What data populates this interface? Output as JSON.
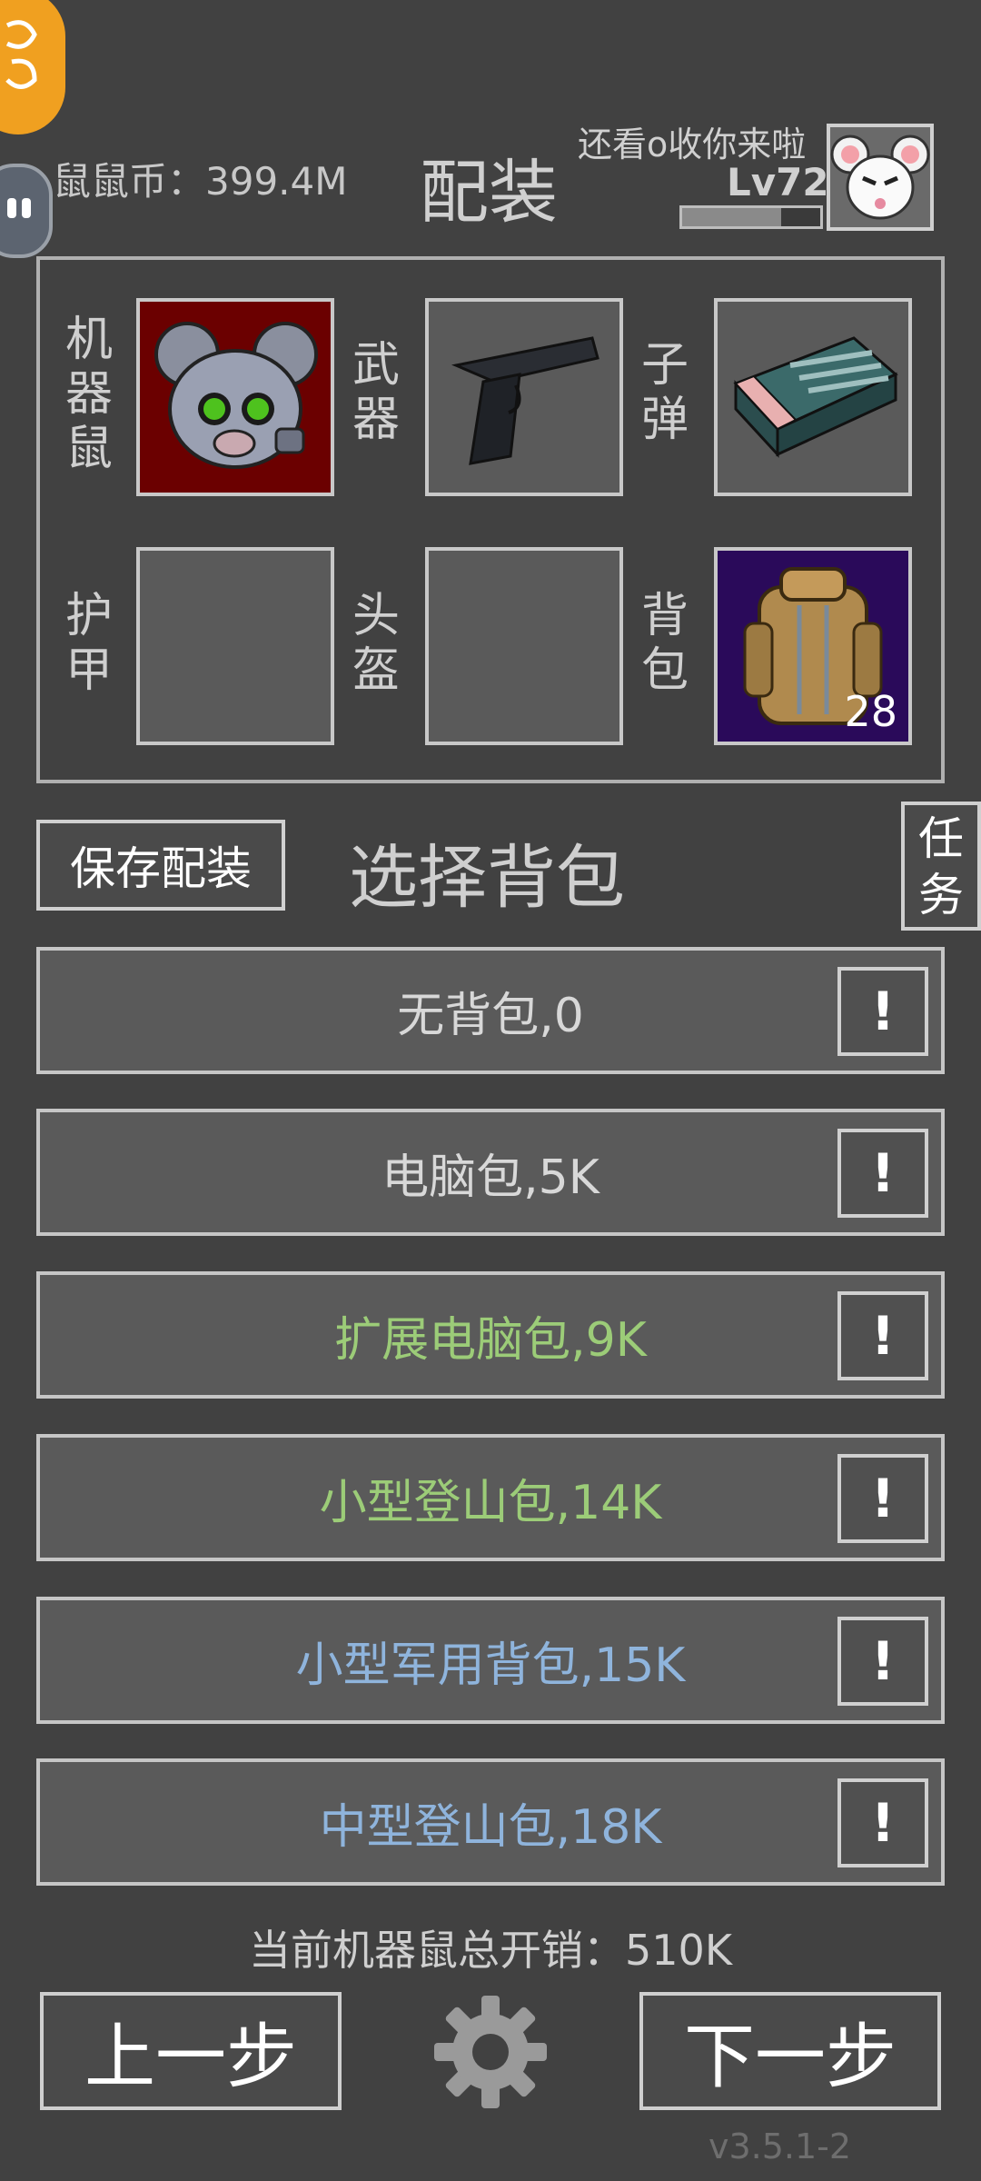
{
  "header": {
    "coins": "鼠鼠币：399.4M",
    "title": "配装",
    "player_name": "还看o收你来啦",
    "level": "Lv72",
    "level_progress": 0.72
  },
  "loadout": {
    "slots": [
      {
        "label": "机器鼠",
        "icon": "robot-mouse-icon",
        "bg": "#6b0000"
      },
      {
        "label": "武器",
        "icon": "pistol-icon",
        "bg": "#5a5a5a"
      },
      {
        "label": "子弹",
        "icon": "ammo-box-icon",
        "bg": "#5a5a5a"
      },
      {
        "label": "护甲",
        "icon": "",
        "bg": "#5a5a5a"
      },
      {
        "label": "头盔",
        "icon": "",
        "bg": "#5a5a5a"
      },
      {
        "label": "背包",
        "icon": "backpack-icon",
        "bg": "#2a0a5a",
        "count": "28"
      }
    ]
  },
  "actions": {
    "save_label": "保存配装",
    "section_title": "选择背包",
    "task_label": "任务"
  },
  "bags": [
    {
      "label": "无背包,0",
      "color": "#d8d8d8",
      "info": "!"
    },
    {
      "label": "电脑包,5K",
      "color": "#d8d8d8",
      "info": "!"
    },
    {
      "label": "扩展电脑包,9K",
      "color": "#9ccc78",
      "info": "!"
    },
    {
      "label": "小型登山包,14K",
      "color": "#9ccc78",
      "info": "!"
    },
    {
      "label": "小型军用背包,15K",
      "color": "#8fb4dc",
      "info": "!"
    },
    {
      "label": "中型登山包,18K",
      "color": "#8fb4dc",
      "info": "!"
    }
  ],
  "footer": {
    "total_cost": "当前机器鼠总开销：510K",
    "prev_label": "上一步",
    "next_label": "下一步",
    "version": "v3.5.1-2"
  }
}
